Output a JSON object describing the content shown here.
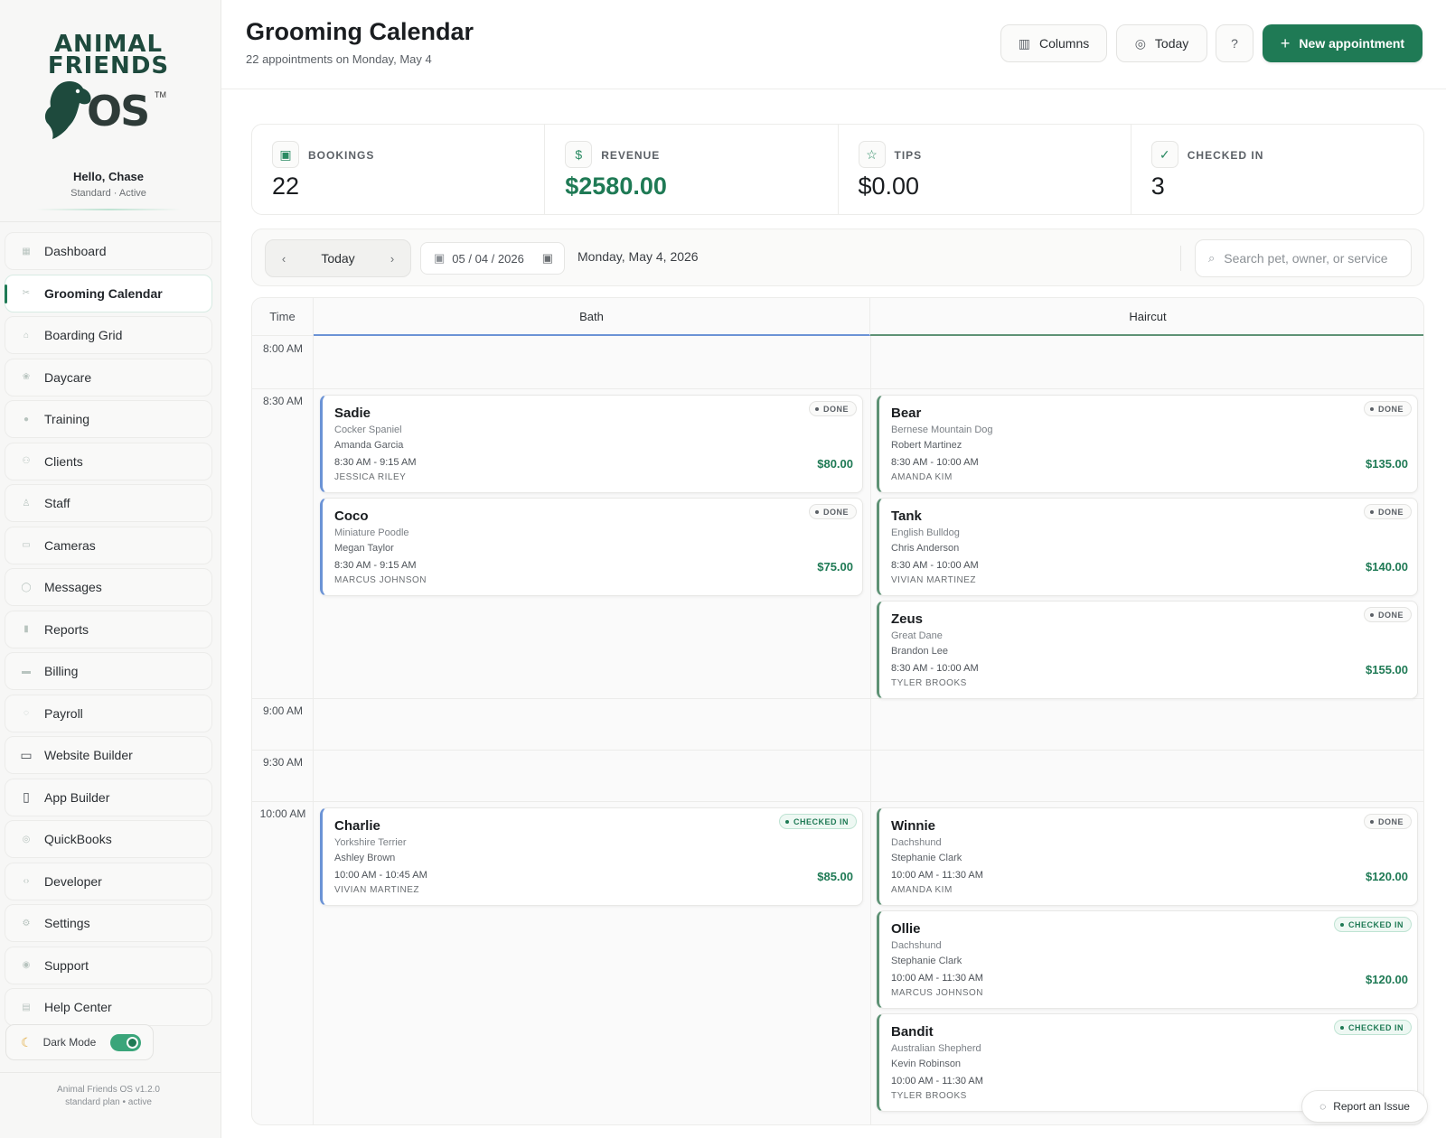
{
  "brand": {
    "logo_line1": "ANIMAL",
    "logo_line2": "FRIENDS",
    "logo_line3": "OS",
    "logo_tm": "TM",
    "greeting": "Hello, Chase",
    "plan_status": "Standard · Active"
  },
  "sidebar": {
    "items": [
      {
        "label": "Dashboard",
        "icon": "dashboard-icon"
      },
      {
        "label": "Grooming Calendar",
        "icon": "scissors-icon",
        "active": true
      },
      {
        "label": "Boarding Grid",
        "icon": "home-icon"
      },
      {
        "label": "Daycare",
        "icon": "paw-icon"
      },
      {
        "label": "Training",
        "icon": "user-icon"
      },
      {
        "label": "Clients",
        "icon": "users-icon"
      },
      {
        "label": "Staff",
        "icon": "staff-icon"
      },
      {
        "label": "Cameras",
        "icon": "camera-icon"
      },
      {
        "label": "Messages",
        "icon": "message-icon"
      },
      {
        "label": "Reports",
        "icon": "bar-chart-icon"
      },
      {
        "label": "Billing",
        "icon": "credit-card-icon"
      },
      {
        "label": "Payroll",
        "icon": "payroll-icon"
      },
      {
        "label": "Website Builder",
        "icon": "browser-window-icon"
      },
      {
        "label": "App Builder",
        "icon": "smartphone-icon"
      },
      {
        "label": "QuickBooks",
        "icon": "quickbooks-icon"
      },
      {
        "label": "Developer",
        "icon": "code-icon"
      },
      {
        "label": "Settings",
        "icon": "gear-icon"
      },
      {
        "label": "Support",
        "icon": "lifebuoy-icon"
      },
      {
        "label": "Help Center",
        "icon": "book-icon"
      }
    ],
    "dark_mode_label": "Dark Mode",
    "dark_mode_on": true,
    "version": "Animal Friends OS v1.2.0",
    "version_plan": "standard plan • active"
  },
  "header": {
    "title": "Grooming Calendar",
    "subtitle": "22 appointments on Monday, May 4",
    "columns_label": "Columns",
    "today_label": "Today",
    "new_label": "New appointment"
  },
  "stats": [
    {
      "label": "BOOKINGS",
      "value": "22",
      "icon": "calendar-icon"
    },
    {
      "label": "REVENUE",
      "value": "$2580.00",
      "icon": "dollar-icon"
    },
    {
      "label": "TIPS",
      "value": "$0.00",
      "icon": "star-icon"
    },
    {
      "label": "CHECKED IN",
      "value": "3",
      "icon": "check-icon"
    }
  ],
  "toolbar": {
    "today_label": "Today",
    "date_value": "05 / 04 / 2026",
    "date_long": "Monday, May 4, 2026",
    "search_placeholder": "Search pet, owner, or service"
  },
  "calendar": {
    "time_header": "Time",
    "columns": [
      "Bath",
      "Haircut"
    ],
    "times": [
      "8:00 AM",
      "8:30 AM",
      "9:00 AM",
      "9:30 AM",
      "10:00 AM"
    ],
    "appointments": [
      {
        "pet": "Sadie",
        "breed": "Cocker Spaniel",
        "owner": "Amanda Garcia",
        "time": "8:30 AM - 9:15 AM",
        "groomer": "JESSICA RILEY",
        "price": "$80.00",
        "status": "DONE"
      },
      {
        "pet": "Coco",
        "breed": "Miniature Poodle",
        "owner": "Megan Taylor",
        "time": "8:30 AM - 9:15 AM",
        "groomer": "MARCUS JOHNSON",
        "price": "$75.00",
        "status": "DONE"
      },
      {
        "pet": "Bear",
        "breed": "Bernese Mountain Dog",
        "owner": "Robert Martinez",
        "time": "8:30 AM - 10:00 AM",
        "groomer": "AMANDA KIM",
        "price": "$135.00",
        "status": "DONE"
      },
      {
        "pet": "Tank",
        "breed": "English Bulldog",
        "owner": "Chris Anderson",
        "time": "8:30 AM - 10:00 AM",
        "groomer": "VIVIAN MARTINEZ",
        "price": "$140.00",
        "status": "DONE"
      },
      {
        "pet": "Zeus",
        "breed": "Great Dane",
        "owner": "Brandon Lee",
        "time": "8:30 AM - 10:00 AM",
        "groomer": "TYLER BROOKS",
        "price": "$155.00",
        "status": "DONE"
      },
      {
        "pet": "Charlie",
        "breed": "Yorkshire Terrier",
        "owner": "Ashley Brown",
        "time": "10:00 AM - 10:45 AM",
        "groomer": "VIVIAN MARTINEZ",
        "price": "$85.00",
        "status": "CHECKED IN"
      },
      {
        "pet": "Winnie",
        "breed": "Dachshund",
        "owner": "Stephanie Clark",
        "time": "10:00 AM - 11:30 AM",
        "groomer": "AMANDA KIM",
        "price": "$120.00",
        "status": "DONE"
      },
      {
        "pet": "Ollie",
        "breed": "Dachshund",
        "owner": "Stephanie Clark",
        "time": "10:00 AM - 11:30 AM",
        "groomer": "MARCUS JOHNSON",
        "price": "$120.00",
        "status": "CHECKED IN"
      },
      {
        "pet": "Bandit",
        "breed": "Australian Shepherd",
        "owner": "Kevin Robinson",
        "time": "10:00 AM - 11:30 AM",
        "groomer": "TYLER BROOKS",
        "price": "",
        "status": "CHECKED IN"
      }
    ]
  },
  "report_label": "Report an Issue",
  "colors": {
    "accent": "#1f7a55",
    "bath": "#6b93d6",
    "haircut": "#5e9275"
  }
}
